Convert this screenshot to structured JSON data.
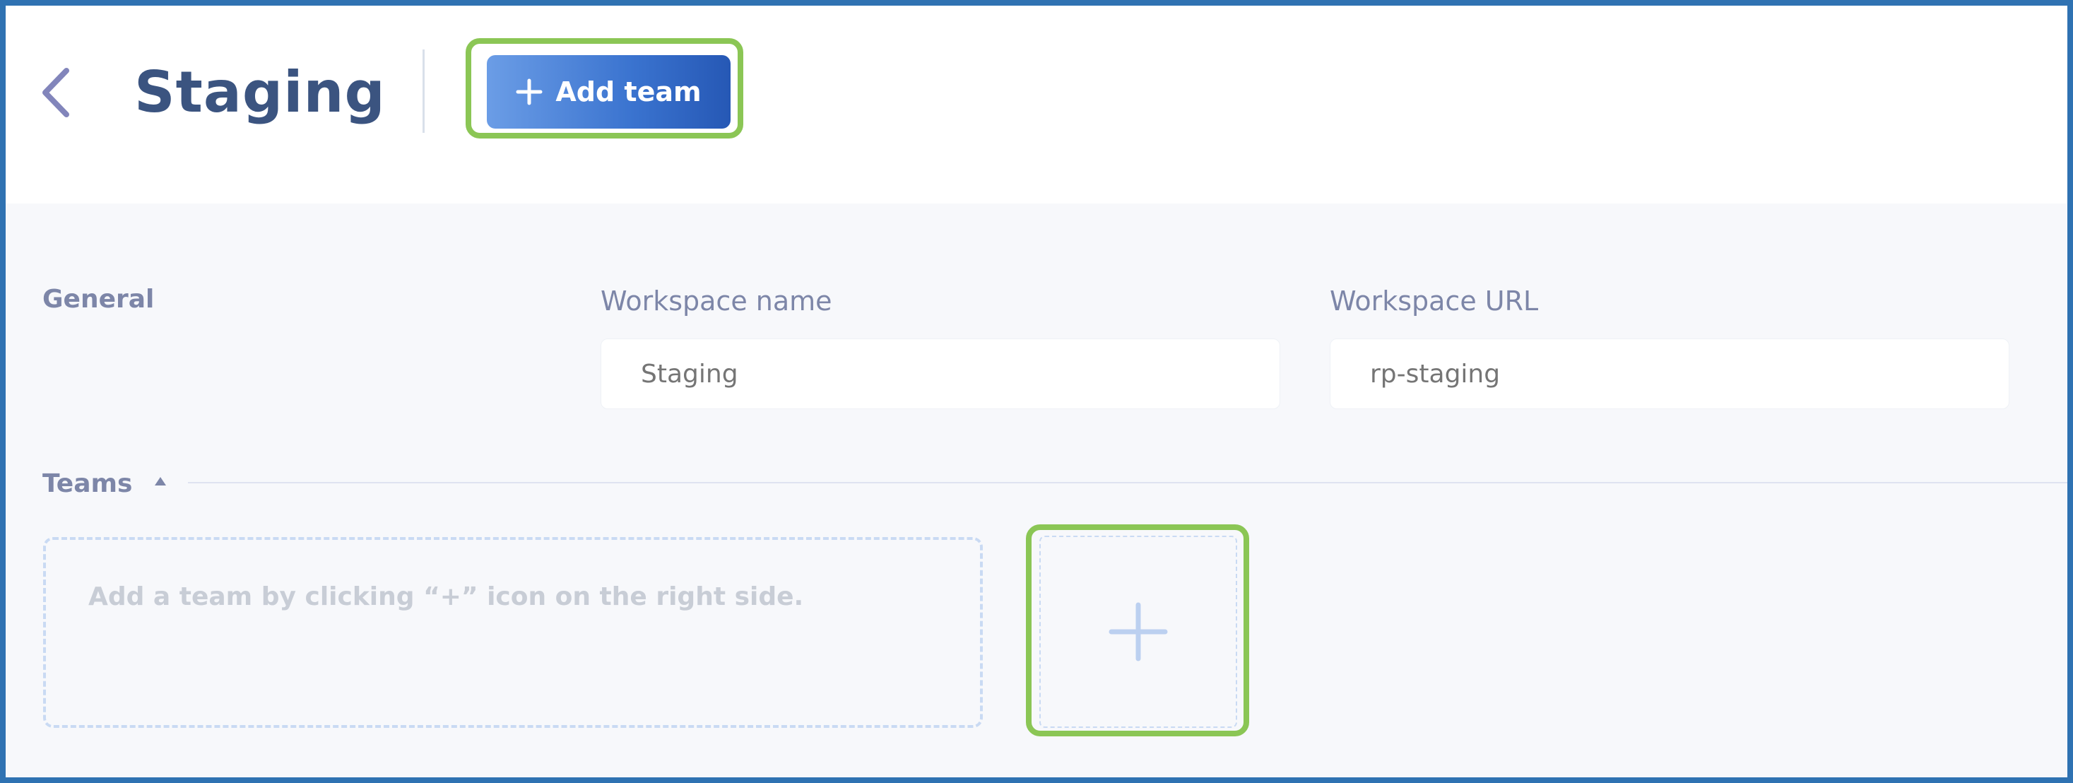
{
  "header": {
    "title": "Staging",
    "add_team_label": "Add team"
  },
  "general": {
    "label": "General",
    "workspace_name": {
      "label": "Workspace name",
      "placeholder": "Staging"
    },
    "workspace_url": {
      "label": "Workspace URL",
      "placeholder": "rp-staging"
    }
  },
  "teams": {
    "label": "Teams",
    "empty_message": "Add a team by clicking “+” icon on the right side."
  },
  "colors": {
    "frame_border": "#2f72b2",
    "highlight": "#8bc655",
    "button_primary": "#3a73cf",
    "title_text": "#3b5480"
  },
  "icons": {
    "back": "chevron-left-icon",
    "add_button": "plus-icon",
    "teams_toggle": "caret-up-icon",
    "add_tile": "plus-icon"
  }
}
